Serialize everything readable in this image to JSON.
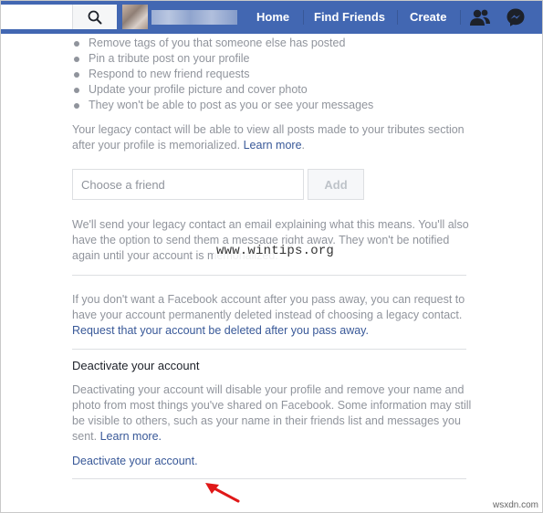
{
  "topbar": {
    "search_placeholder": "",
    "nav": [
      "Home",
      "Find Friends",
      "Create"
    ],
    "icons": [
      "search-icon",
      "friends-icon",
      "messenger-icon"
    ],
    "color": "#4267b2"
  },
  "content": {
    "bullets": [
      "Remove tags of you that someone else has posted",
      "Pin a tribute post on your profile",
      "Respond to new friend requests",
      "Update your profile picture and cover photo",
      "They won't be able to post as you or see your messages"
    ],
    "legacy_text": "Your legacy contact will be able to view all posts made to your tributes section after your profile is memorialized.",
    "legacy_link": "Learn more",
    "friend_placeholder": "Choose a friend",
    "add_label": "Add",
    "email_note": "We'll send your legacy contact an email explaining what this means. You'll also have the option to send them a message right away. They won't be notified again until your account is memorialized.",
    "watermark": "www.wintips.org",
    "delete_text": "If you don't want a Facebook account after you pass away, you can request to have your account permanently deleted instead of choosing a legacy contact.",
    "delete_link": "Request that your account be deleted after you pass away.",
    "deactivate_title": "Deactivate your account",
    "deactivate_text": "Deactivating your account will disable your profile and remove your name and photo from most things you've shared on Facebook. Some information may still be visible to others, such as your name in their friends list and messages you sent.",
    "deactivate_learn_more": "Learn more.",
    "deactivate_link": "Deactivate your account.",
    "corner_mark": "wsxdn.com"
  }
}
